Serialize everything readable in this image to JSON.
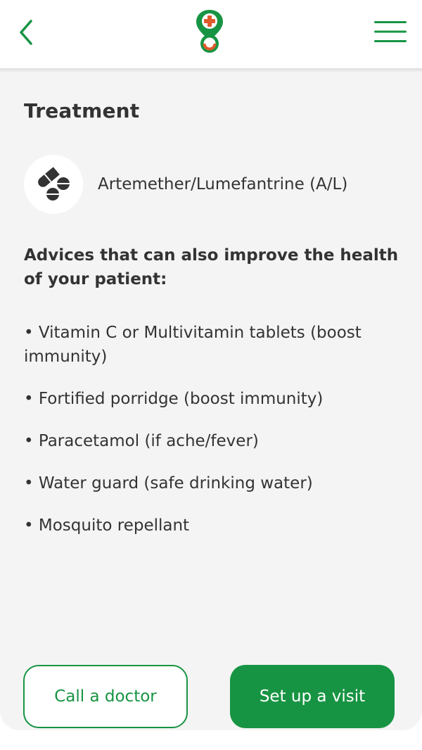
{
  "header": {
    "back_icon": "chevron-left-icon",
    "logo_icon": "medical-pin-logo",
    "menu_icon": "hamburger-menu-icon"
  },
  "colors": {
    "accent": "#179443",
    "logo_red": "#e05a2b",
    "background": "#f4f4f4"
  },
  "main": {
    "title": "Treatment",
    "medication": {
      "icon": "pills-icon",
      "name": "Artemether/Lumefantrine (A/L)"
    },
    "advice_heading": "Advices that can also improve the health of your patient:",
    "advices": [
      "• Vitamin C or Multivitamin tablets (boost immunity)",
      "• Fortified porridge (boost immunity)",
      "• Paracetamol (if ache/fever)",
      "• Water guard (safe drinking water)",
      "• Mosquito repellant"
    ]
  },
  "actions": {
    "call_label": "Call a doctor",
    "visit_label": "Set up a visit"
  }
}
